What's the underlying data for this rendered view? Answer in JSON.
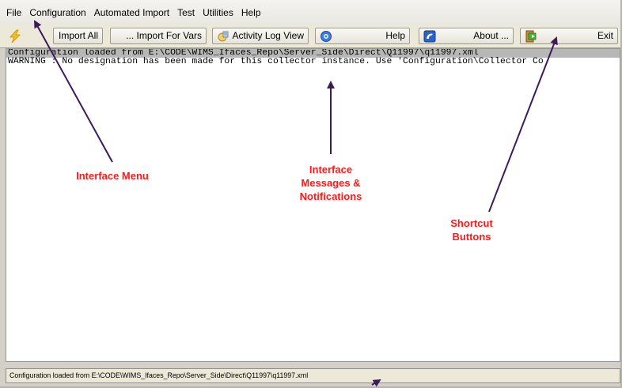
{
  "menu": [
    "File",
    "Configuration",
    "Automated Import",
    "Test",
    "Utilities",
    "Help"
  ],
  "toolbar": {
    "import_all": "Import All",
    "import_for_vars": "... Import For Vars",
    "activity_log": "Activity Log View",
    "help": "Help",
    "about": "About ...",
    "exit": "Exit"
  },
  "messages": [
    "Configuration loaded from E:\\CODE\\WIMS_Ifaces_Repo\\Server_Side\\Direct\\Q11997\\q11997.xml",
    "WARNING : No designation has been made for this collector instance. Use 'Configuration\\Collector Co"
  ],
  "status": "Configuration loaded from E:\\CODE\\WIMS_Ifaces_Repo\\Server_Side\\Direct\\Q11997\\q11997.xml",
  "annotations": {
    "menu": "Interface Menu",
    "messages": "Interface Messages & Notifications",
    "shortcuts": "Shortcut Buttons"
  },
  "colors": {
    "annotation": "#ff1a1a",
    "arrow": "#3d1a5c"
  }
}
